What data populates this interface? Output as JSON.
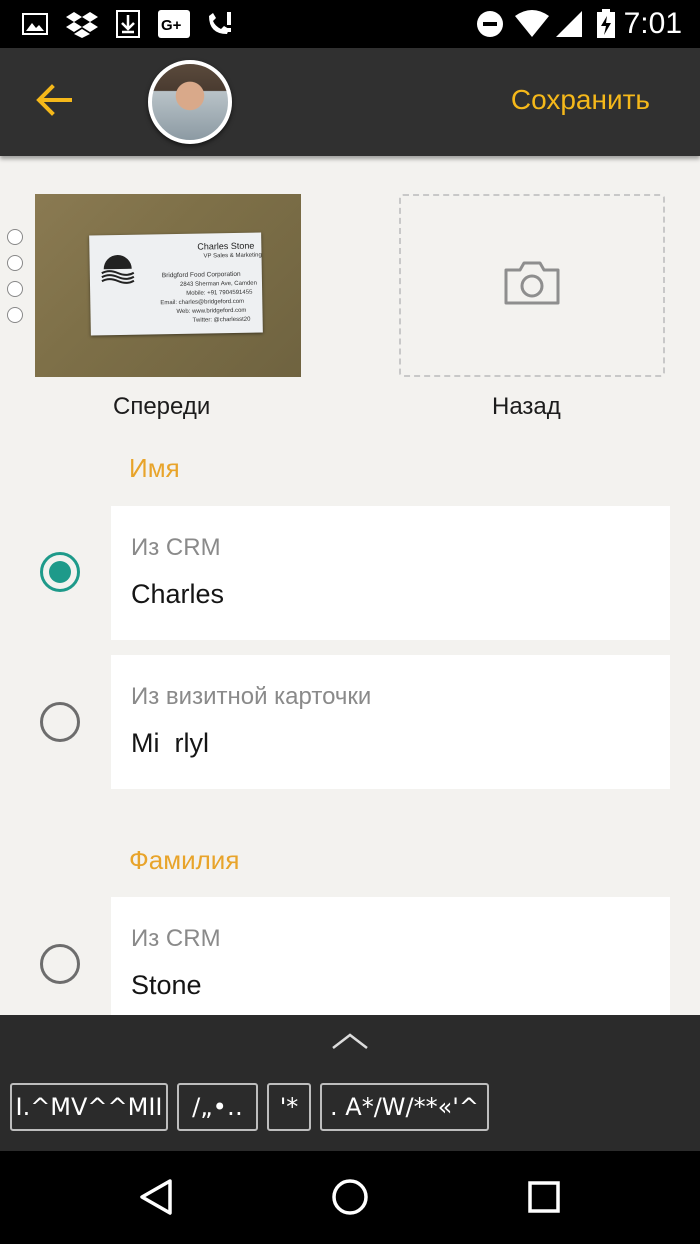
{
  "status_bar": {
    "time": "7:01",
    "icons": [
      "image-icon",
      "dropbox-icon",
      "download-icon",
      "google-plus-icon",
      "missed-call-icon",
      "do-not-disturb-icon",
      "wifi-icon",
      "signal-icon",
      "battery-charging-icon"
    ]
  },
  "toolbar": {
    "back_icon": "arrow-left-icon",
    "save_label": "Сохранить",
    "accent_color": "#f5b81a"
  },
  "photos": {
    "front_label": "Спереди",
    "back_label": "Назад",
    "card": {
      "name": "Charles Stone",
      "title": "VP Sales & Marketing",
      "company": "Bridgford Food Corporation",
      "address": "2843 Sherman Ave, Camden",
      "mobile": "Mobile: +91 7904591455",
      "email": "Email: charles@bridgeford.com",
      "web": "Web: www.bridgeford.com",
      "twitter": "Twitter: @charlesst20"
    }
  },
  "sections": {
    "first_name": {
      "title": "Имя",
      "options": [
        {
          "source": "Из CRM",
          "value": "Charles",
          "selected": true
        },
        {
          "source": "Из визитной карточки",
          "value": "Mi  rlyl",
          "selected": false
        }
      ]
    },
    "last_name": {
      "title": "Фамилия",
      "options": [
        {
          "source": "Из CRM",
          "value": "Stone",
          "selected": false
        }
      ]
    }
  },
  "suggestions": {
    "chips": [
      "I.^MV^^MII",
      "/„•‥",
      "'*",
      ". A*/W/**«'^"
    ]
  },
  "nav": {
    "icons": [
      "back-triangle-icon",
      "home-circle-icon",
      "recents-square-icon"
    ]
  },
  "colors": {
    "radio_selected": "#1e9a8a",
    "section_title": "#e8a42a"
  }
}
